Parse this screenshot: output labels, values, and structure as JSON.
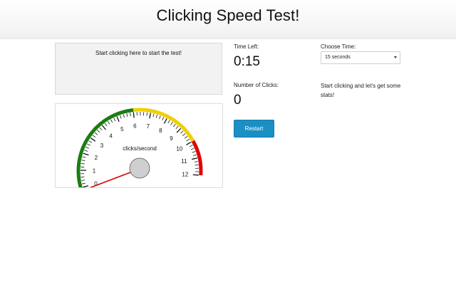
{
  "header": {
    "title": "Clicking Speed Test!"
  },
  "click_area": {
    "prompt": "Start clicking here to start the test!"
  },
  "gauge": {
    "unit_label": "clicks/second",
    "ticks": [
      "0",
      "1",
      "2",
      "3",
      "4",
      "5",
      "6",
      "7",
      "8",
      "9",
      "10",
      "11",
      "12"
    ],
    "max": 12,
    "value": 0,
    "colors": {
      "low": "#1a7d12",
      "mid": "#f0d000",
      "high": "#e00000",
      "needle": "#d40000",
      "hub": "#cfcfcf"
    }
  },
  "timer": {
    "label": "Time Left:",
    "value": "0:15"
  },
  "clicks": {
    "label": "Number of Clicks:",
    "value": "0"
  },
  "choose_time": {
    "label": "Choose Time:",
    "selected": "15 seconds"
  },
  "stats_text": "Start clicking and let's get some stats!",
  "restart": {
    "label": "Restart"
  }
}
